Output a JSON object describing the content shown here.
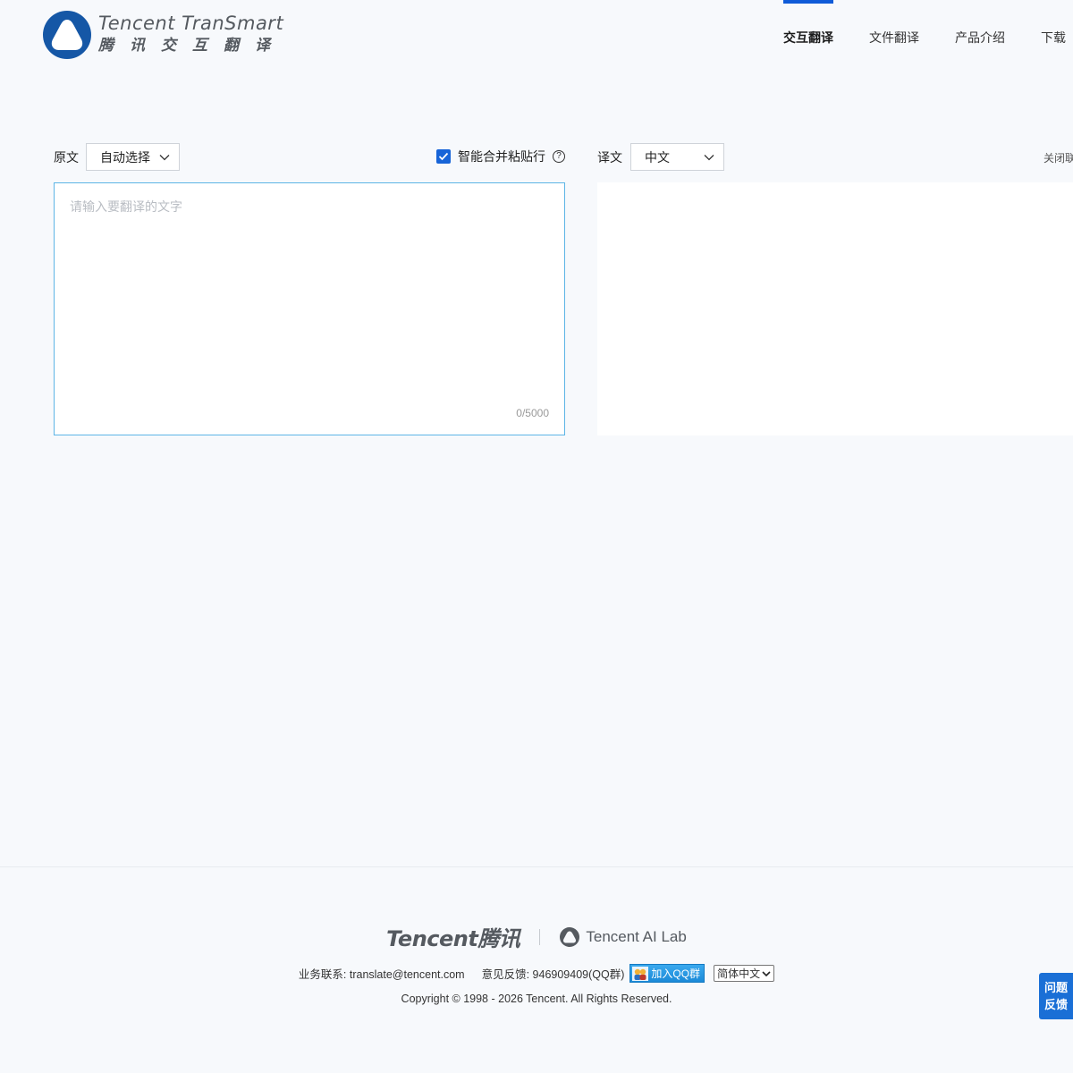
{
  "brand": {
    "name_en": "Tencent TranSmart",
    "name_cn": "腾讯交互翻译"
  },
  "nav": [
    {
      "label": "交互翻译",
      "active": true
    },
    {
      "label": "文件翻译",
      "active": false
    },
    {
      "label": "产品介绍",
      "active": false
    },
    {
      "label": "下载",
      "active": false
    }
  ],
  "source": {
    "label": "原文",
    "language": "自动选择",
    "placeholder": "请输入要翻译的文字",
    "char_count": "0/5000",
    "smart_paste": {
      "label": "智能合并粘贴行",
      "checked": true
    }
  },
  "target": {
    "label": "译文",
    "language": "中文",
    "close_link": "关闭联"
  },
  "footer": {
    "tencent_logo": "Tencent腾讯",
    "ailab": "Tencent AI Lab",
    "contact": "业务联系: translate@tencent.com",
    "feedback": "意见反馈: 946909409(QQ群)",
    "qq_button": "加入QQ群",
    "language_select": "简体中文",
    "copyright": "Copyright © 1998 - 2026 Tencent. All Rights Reserved."
  },
  "feedback_widget": {
    "line1": "问题",
    "line2": "反馈"
  },
  "colors": {
    "accent": "#0f5bd8",
    "checkbox": "#1764d8",
    "input_border": "#5db5e6",
    "feedback_bg": "#1a6fd6"
  }
}
